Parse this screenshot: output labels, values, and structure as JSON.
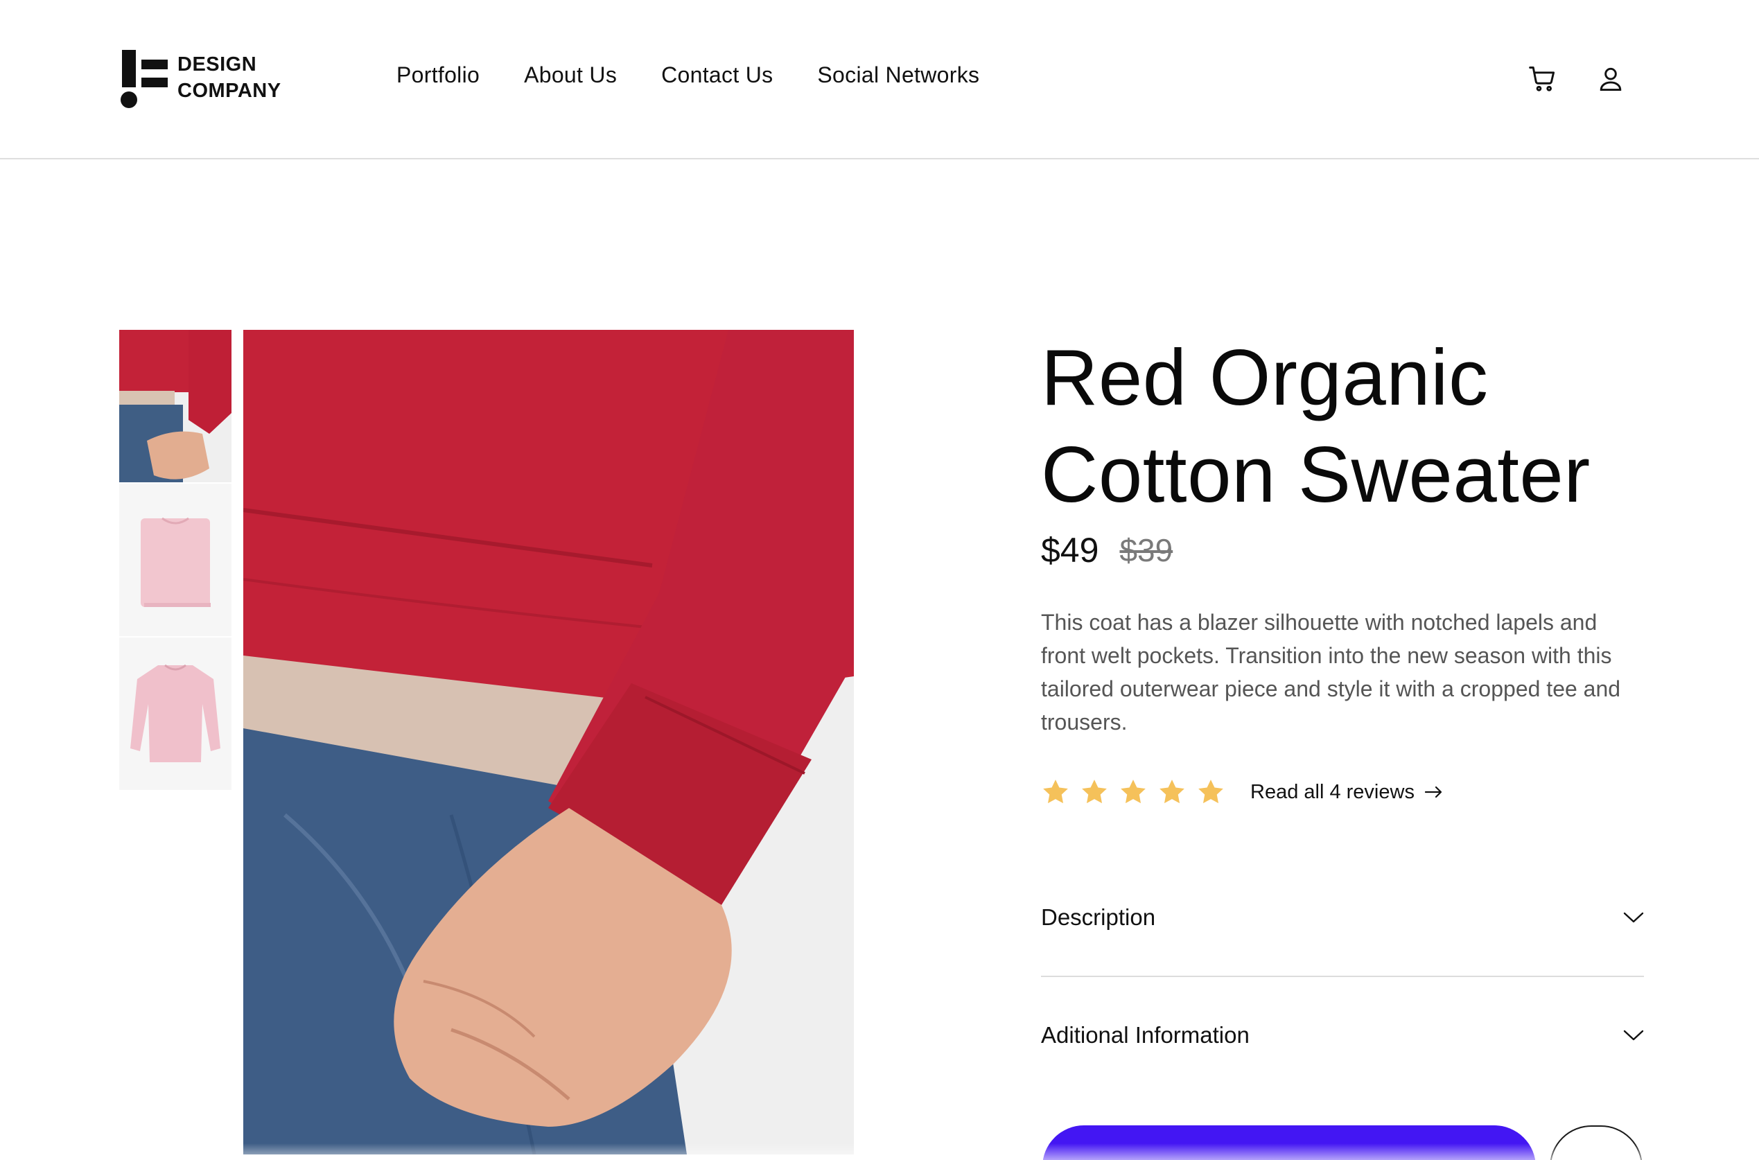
{
  "brand": {
    "line1": "DESIGN",
    "line2": "COMPANY"
  },
  "nav": {
    "items": [
      "Portfolio",
      "About Us",
      "Contact Us",
      "Social Networks"
    ]
  },
  "header_icons": [
    "cart-icon",
    "user-icon"
  ],
  "gallery": {
    "thumbnails": [
      "red-sweater-cuff-closeup",
      "pink-sweater-folded",
      "pink-sweater-flat"
    ],
    "main_image": "red-sweater-cuff-closeup"
  },
  "product": {
    "title_line1": "Red Organic",
    "title_line2": "Cotton Sweater",
    "price": "$49",
    "old_price": "$39",
    "description": "This coat has a blazer silhouette with notched lapels and front welt pockets. Transition into the new season with this tailored outerwear piece and style it with a cropped tee and trousers.",
    "rating": 5,
    "rating_max": 5,
    "reviews_link": "Read all 4 reviews"
  },
  "accordion": [
    {
      "label": "Description"
    },
    {
      "label": "Aditional Information"
    }
  ],
  "colors": {
    "star": "#F5C15A",
    "cta": "#4316F3",
    "divider": "#DCDCDC"
  }
}
